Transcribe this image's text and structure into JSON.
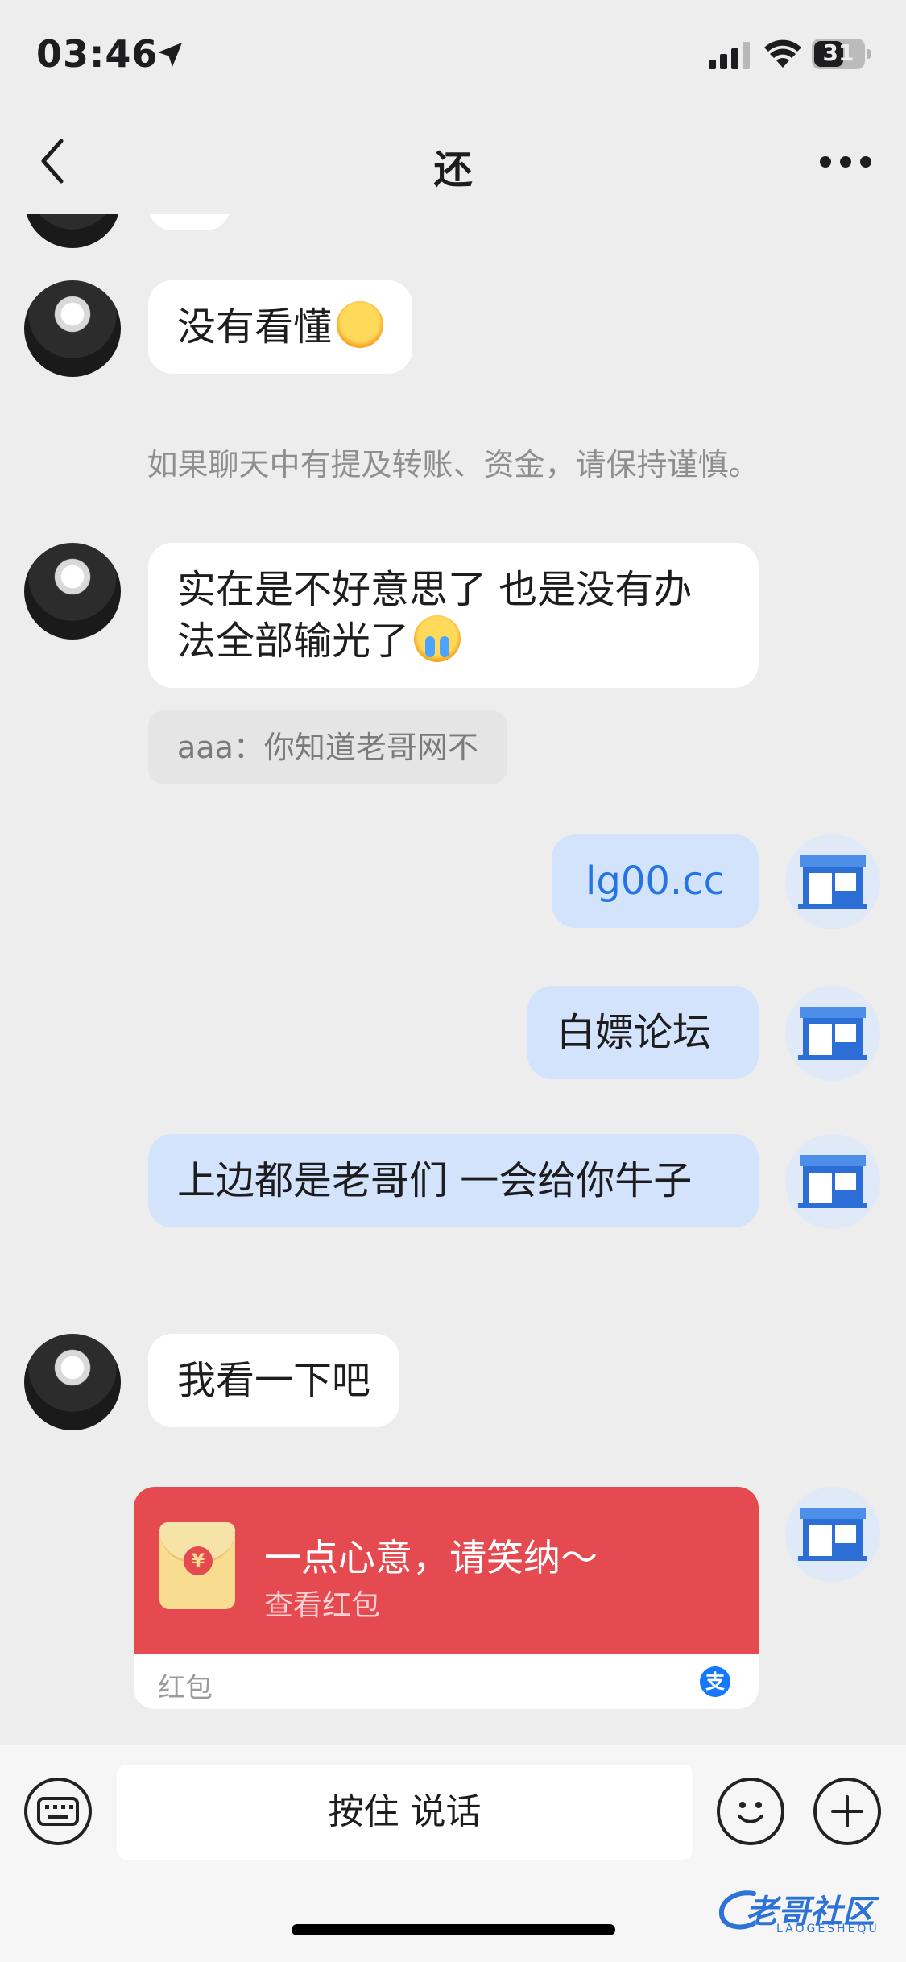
{
  "status_bar": {
    "time": "03:46",
    "battery": "31"
  },
  "nav": {
    "title": "还"
  },
  "chat": {
    "messages": [
      {
        "text": "没有看懂"
      },
      {
        "notice": "如果聊天中有提及转账、资金，请保持谨慎。"
      },
      {
        "text": "实在是不好意思了 也是没有办法全部输光了",
        "quote": "aaa：你知道老哥网不"
      },
      {
        "text": "lg00.cc"
      },
      {
        "text": "白嫖论坛"
      },
      {
        "text": "上边都是老哥们 一会给你牛子"
      },
      {
        "text": "我看一下吧"
      }
    ],
    "red_packet": {
      "title": "一点心意，请笑纳～",
      "subtitle": "查看红包",
      "footer": "红包",
      "symbol": "¥",
      "pay_badge": "支"
    }
  },
  "input_bar": {
    "voice_label": "按住 说话"
  },
  "watermark": {
    "text": "老哥社区",
    "sub": "LAOGESHEQU"
  },
  "colors": {
    "accent": "#2474e5",
    "red_packet": "#e64a51",
    "my_bubble": "#d2e3fb"
  }
}
